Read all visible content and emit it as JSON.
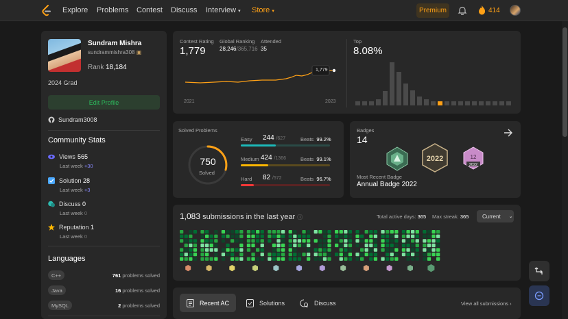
{
  "nav": {
    "links": [
      "Explore",
      "Problems",
      "Contest",
      "Discuss",
      "Interview",
      "Store"
    ],
    "premium": "Premium",
    "streak": "414"
  },
  "profile": {
    "name": "Sundram Mishra",
    "username": "sundrammishra308",
    "rank_label": "Rank",
    "rank": "18,184",
    "grad": "2024 Grad",
    "edit": "Edit Profile",
    "github": "Sundram3008"
  },
  "community": {
    "title": "Community Stats",
    "items": [
      {
        "label": "Views",
        "value": "565",
        "week": "Last week",
        "delta": "+30",
        "color": "#6a6aff"
      },
      {
        "label": "Solution",
        "value": "28",
        "week": "Last week",
        "delta": "+3",
        "color": "#4aa8ff"
      },
      {
        "label": "Discuss",
        "value": "0",
        "week": "Last week",
        "delta": "0",
        "color": "#2cbbb0"
      },
      {
        "label": "Reputation",
        "value": "1",
        "week": "Last week",
        "delta": "0",
        "color": "#ffb800"
      }
    ]
  },
  "languages": {
    "title": "Languages",
    "items": [
      {
        "name": "C++",
        "count": "761",
        "suffix": "problems solved"
      },
      {
        "name": "Java",
        "count": "16",
        "suffix": "problems solved"
      },
      {
        "name": "MySQL",
        "count": "2",
        "suffix": "problems solved"
      }
    ]
  },
  "contest": {
    "rating_label": "Contest Rating",
    "rating": "1,779",
    "global_label": "Global Ranking",
    "global": "28,246",
    "global_total": "/365,716",
    "attended_label": "Attended",
    "attended": "35",
    "top_label": "Top",
    "top": "8.08%",
    "tooltip": "1,779",
    "year_start": "2021",
    "year_end": "2023"
  },
  "solved": {
    "title": "Solved Problems",
    "total": "750",
    "total_label": "Solved",
    "rows": [
      {
        "name": "Easy",
        "count": "244",
        "total": "/627",
        "beats_label": "Beats",
        "beats": "99.2%",
        "color": "#1cbaba",
        "track": "#2a4a46",
        "fill": 0.389
      },
      {
        "name": "Medium",
        "count": "424",
        "total": "/1366",
        "beats_label": "Beats",
        "beats": "99.1%",
        "color": "#ffb700",
        "track": "#5a4a1e",
        "fill": 0.31
      },
      {
        "name": "Hard",
        "count": "82",
        "total": "/572",
        "beats_label": "Beats",
        "beats": "96.7%",
        "color": "#f63737",
        "track": "#5a2323",
        "fill": 0.143
      }
    ]
  },
  "badges": {
    "title": "Badges",
    "count": "14",
    "recent_label": "Most Recent Badge",
    "recent": "Annual Badge 2022"
  },
  "submissions": {
    "count": "1,083",
    "text": "submissions in the last year",
    "active_label": "Total active days:",
    "active": "365",
    "streak_label": "Max streak:",
    "streak": "365",
    "current": "Current"
  },
  "tabs": {
    "recent": "Recent AC",
    "solutions": "Solutions",
    "discuss": "Discuss",
    "view_all": "View all submissions"
  }
}
